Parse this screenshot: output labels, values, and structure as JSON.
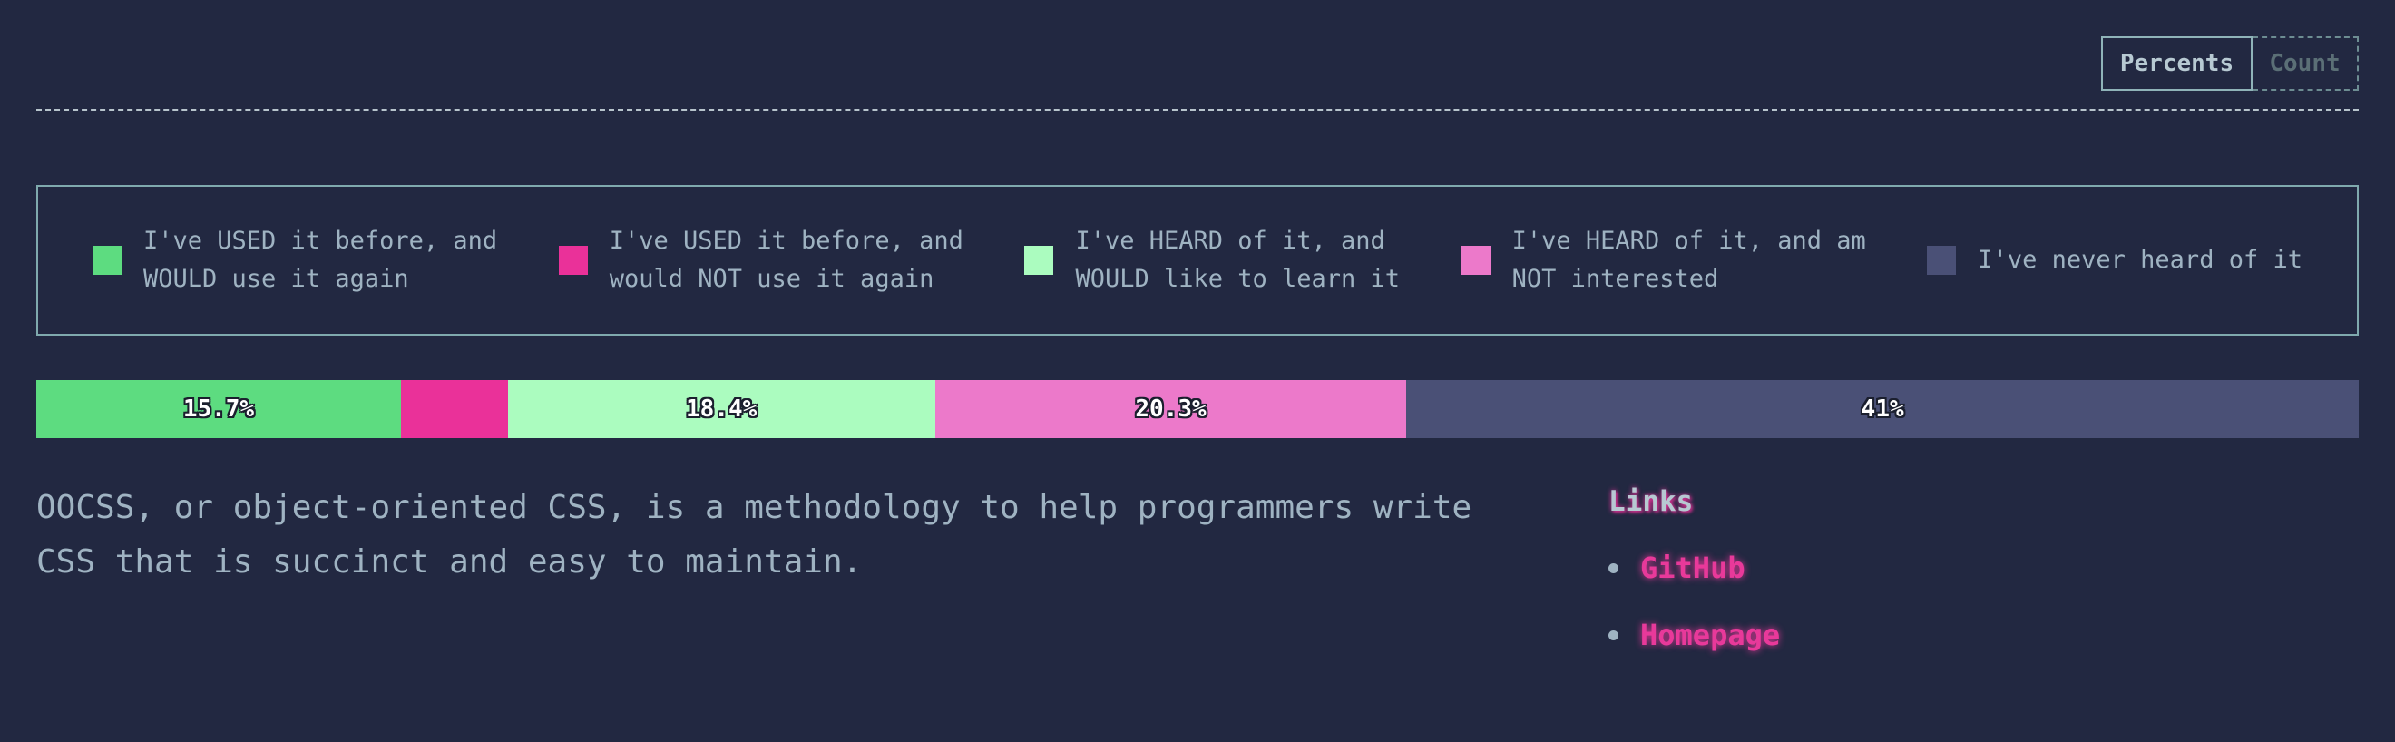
{
  "toggle": {
    "percents_label": "Percents",
    "count_label": "Count",
    "active": "Percents"
  },
  "legend": [
    {
      "label": "I've USED it before, and\nWOULD use it again",
      "color": "#5ddc80"
    },
    {
      "label": "I've USED it before, and\nwould NOT use it again",
      "color": "#ea3199"
    },
    {
      "label": "I've HEARD of it, and\nWOULD like to learn it",
      "color": "#abfcbf"
    },
    {
      "label": "I've HEARD of it, and am\nNOT interested",
      "color": "#ec79ca"
    },
    {
      "label": "I've never heard of it",
      "color": "#4a5076"
    }
  ],
  "bar": {
    "segments": [
      {
        "percent": 15.7,
        "label": "15.7%",
        "color": "#5ddc80"
      },
      {
        "percent": 4.6,
        "label": "",
        "color": "#ea3199"
      },
      {
        "percent": 18.4,
        "label": "18.4%",
        "color": "#abfcbf"
      },
      {
        "percent": 20.3,
        "label": "20.3%",
        "color": "#ec79ca"
      },
      {
        "percent": 41,
        "label": "41%",
        "color": "#4a5076"
      }
    ]
  },
  "description": "OOCSS, or object-oriented CSS, is a methodology to help programmers write CSS that is succinct and easy to maintain.",
  "links": {
    "title": "Links",
    "items": [
      {
        "label": "GitHub"
      },
      {
        "label": "Homepage"
      }
    ]
  }
}
